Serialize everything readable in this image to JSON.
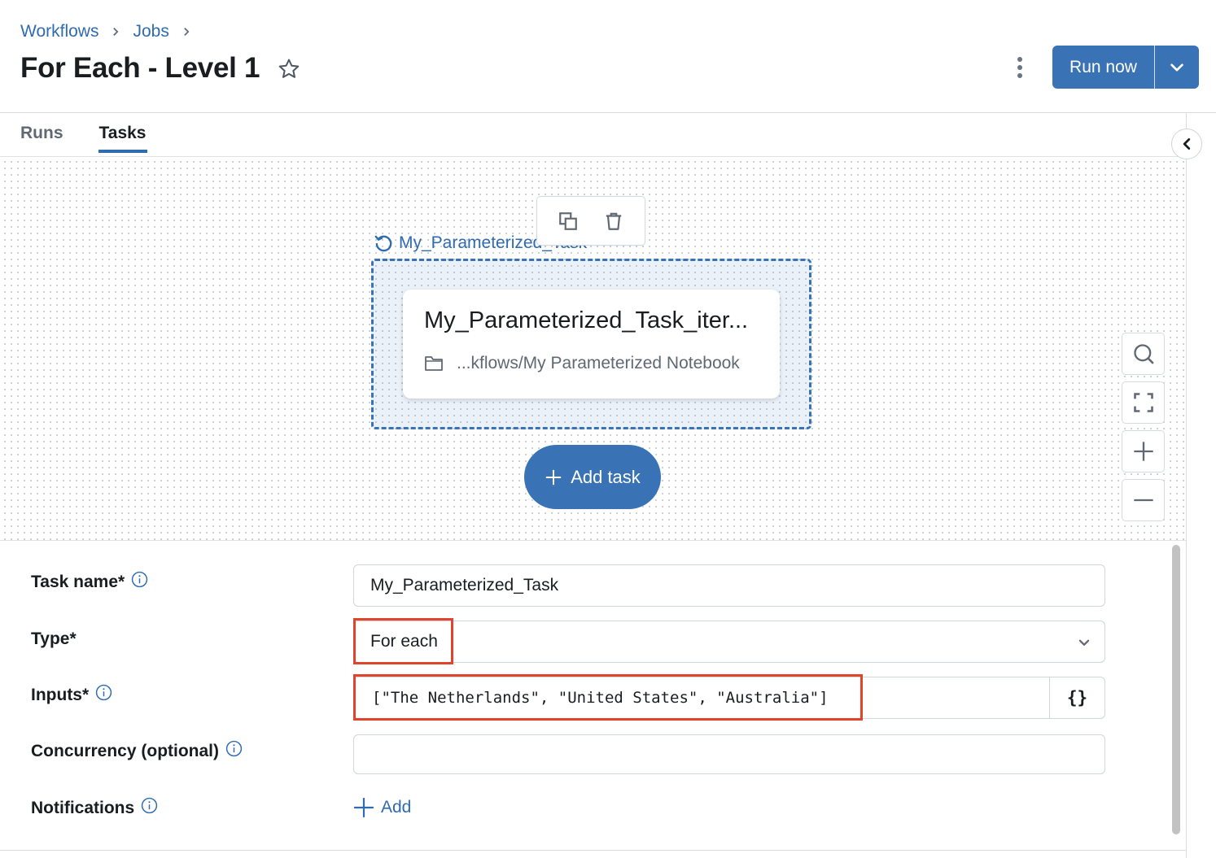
{
  "breadcrumb": [
    {
      "label": "Workflows"
    },
    {
      "label": "Jobs"
    }
  ],
  "header": {
    "title": "For Each - Level 1",
    "favorite_icon": "star-outline-icon",
    "more_icon": "kebab-vertical-icon",
    "run_now_label": "Run now",
    "run_menu_icon": "chevron-down-icon"
  },
  "tabs": [
    {
      "label": "Runs",
      "active": false
    },
    {
      "label": "Tasks",
      "active": true
    }
  ],
  "canvas": {
    "node_toolbar": {
      "clone_icon": "clone-icon",
      "delete_icon": "trash-icon"
    },
    "foreach_node": {
      "icon": "loop-arrow-icon",
      "label": "My_Parameterized_Task"
    },
    "nested_task": {
      "title": "My_Parameterized_Task_iter...",
      "path_icon": "folder-icon",
      "path": "...kflows/My Parameterized Notebook"
    },
    "add_task_label": "Add task",
    "zoom_controls": [
      "search-icon",
      "fit-view-icon",
      "zoom-in-icon",
      "zoom-out-icon"
    ]
  },
  "form": {
    "task_name": {
      "label": "Task name*",
      "value": "My_Parameterized_Task"
    },
    "type": {
      "label": "Type*",
      "value": "For each"
    },
    "inputs": {
      "label": "Inputs*",
      "value": "[\"The Netherlands\", \"United States\", \"Australia\"]",
      "json_button": "{}"
    },
    "concurrency": {
      "label": "Concurrency (optional)",
      "value": ""
    },
    "notifications": {
      "label": "Notifications",
      "add_label": "Add"
    }
  },
  "colors": {
    "primary": "#3a72b6",
    "link": "#2f6bb0",
    "highlight": "#e0452c"
  }
}
